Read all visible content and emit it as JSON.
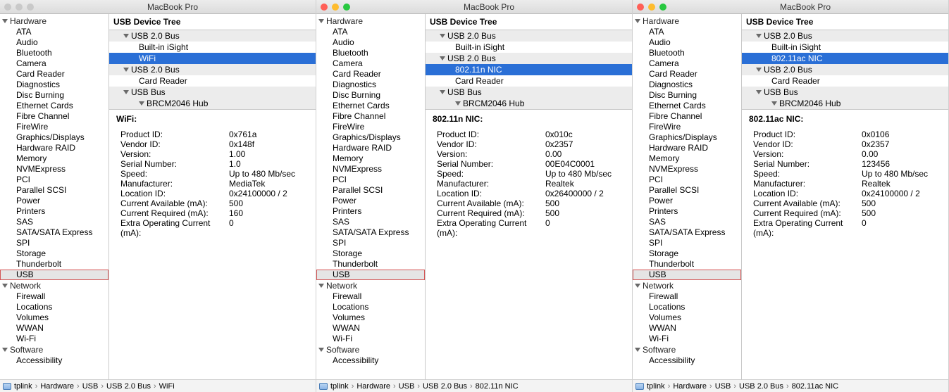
{
  "windows": [
    {
      "title": "MacBook Pro",
      "traffic_colored": false,
      "sidebar": {
        "groups": [
          {
            "label": "Hardware",
            "items": [
              "ATA",
              "Audio",
              "Bluetooth",
              "Camera",
              "Card Reader",
              "Diagnostics",
              "Disc Burning",
              "Ethernet Cards",
              "Fibre Channel",
              "FireWire",
              "Graphics/Displays",
              "Hardware RAID",
              "Memory",
              "NVMExpress",
              "PCI",
              "Parallel SCSI",
              "Power",
              "Printers",
              "SAS",
              "SATA/SATA Express",
              "SPI",
              "Storage",
              "Thunderbolt",
              "USB"
            ],
            "selected": "USB",
            "boxed": "USB"
          },
          {
            "label": "Network",
            "items": [
              "Firewall",
              "Locations",
              "Volumes",
              "WWAN",
              "Wi-Fi"
            ]
          },
          {
            "label": "Software",
            "items": [
              "Accessibility"
            ]
          }
        ]
      },
      "tree": {
        "header": "USB Device Tree",
        "rows": [
          {
            "type": "bus",
            "label": "USB 2.0 Bus"
          },
          {
            "type": "dev",
            "label": "Built-in iSight"
          },
          {
            "type": "dev",
            "label": "WiFi",
            "selected": true
          },
          {
            "type": "bus",
            "label": "USB 2.0 Bus"
          },
          {
            "type": "dev",
            "label": "Card Reader"
          },
          {
            "type": "bus",
            "label": "USB Bus"
          },
          {
            "type": "bus",
            "label": "BRCM2046 Hub",
            "indent": 1
          }
        ]
      },
      "detail": {
        "heading": "WiFi:",
        "rows": [
          {
            "k": "Product ID:",
            "v": "0x761a"
          },
          {
            "k": "Vendor ID:",
            "v": "0x148f"
          },
          {
            "k": "Version:",
            "v": "1.00"
          },
          {
            "k": "Serial Number:",
            "v": "1.0"
          },
          {
            "k": "Speed:",
            "v": "Up to 480 Mb/sec"
          },
          {
            "k": "Manufacturer:",
            "v": "MediaTek"
          },
          {
            "k": "Location ID:",
            "v": "0x24100000 / 2"
          },
          {
            "k": "Current Available (mA):",
            "v": "500"
          },
          {
            "k": "Current Required (mA):",
            "v": "160"
          },
          {
            "k": "Extra Operating Current (mA):",
            "v": "0"
          }
        ]
      },
      "breadcrumb": [
        "tplink",
        "Hardware",
        "USB",
        "USB 2.0 Bus",
        "WiFi"
      ]
    },
    {
      "title": "MacBook Pro",
      "traffic_colored": true,
      "sidebar": {
        "groups": [
          {
            "label": "Hardware",
            "items": [
              "ATA",
              "Audio",
              "Bluetooth",
              "Camera",
              "Card Reader",
              "Diagnostics",
              "Disc Burning",
              "Ethernet Cards",
              "Fibre Channel",
              "FireWire",
              "Graphics/Displays",
              "Hardware RAID",
              "Memory",
              "NVMExpress",
              "PCI",
              "Parallel SCSI",
              "Power",
              "Printers",
              "SAS",
              "SATA/SATA Express",
              "SPI",
              "Storage",
              "Thunderbolt",
              "USB"
            ],
            "selected": "USB",
            "boxed": "USB"
          },
          {
            "label": "Network",
            "items": [
              "Firewall",
              "Locations",
              "Volumes",
              "WWAN",
              "Wi-Fi"
            ]
          },
          {
            "label": "Software",
            "items": [
              "Accessibility"
            ]
          }
        ]
      },
      "tree": {
        "header": "USB Device Tree",
        "rows": [
          {
            "type": "bus",
            "label": "USB 2.0 Bus"
          },
          {
            "type": "dev",
            "label": "Built-in iSight"
          },
          {
            "type": "bus",
            "label": "USB 2.0 Bus"
          },
          {
            "type": "dev",
            "label": "802.11n NIC",
            "selected": true
          },
          {
            "type": "dev",
            "label": "Card Reader"
          },
          {
            "type": "bus",
            "label": "USB Bus"
          },
          {
            "type": "bus",
            "label": "BRCM2046 Hub",
            "indent": 1
          }
        ]
      },
      "detail": {
        "heading": "802.11n NIC:",
        "rows": [
          {
            "k": "Product ID:",
            "v": "0x010c"
          },
          {
            "k": "Vendor ID:",
            "v": "0x2357"
          },
          {
            "k": "Version:",
            "v": "0.00"
          },
          {
            "k": "Serial Number:",
            "v": "00E04C0001"
          },
          {
            "k": "Speed:",
            "v": "Up to 480 Mb/sec"
          },
          {
            "k": "Manufacturer:",
            "v": "Realtek"
          },
          {
            "k": "Location ID:",
            "v": "0x26400000 / 2"
          },
          {
            "k": "Current Available (mA):",
            "v": "500"
          },
          {
            "k": "Current Required (mA):",
            "v": "500"
          },
          {
            "k": "Extra Operating Current (mA):",
            "v": "0"
          }
        ]
      },
      "breadcrumb": [
        "tplink",
        "Hardware",
        "USB",
        "USB 2.0 Bus",
        "802.11n NIC"
      ]
    },
    {
      "title": "MacBook Pro",
      "traffic_colored": true,
      "sidebar": {
        "groups": [
          {
            "label": "Hardware",
            "items": [
              "ATA",
              "Audio",
              "Bluetooth",
              "Camera",
              "Card Reader",
              "Diagnostics",
              "Disc Burning",
              "Ethernet Cards",
              "Fibre Channel",
              "FireWire",
              "Graphics/Displays",
              "Hardware RAID",
              "Memory",
              "NVMExpress",
              "PCI",
              "Parallel SCSI",
              "Power",
              "Printers",
              "SAS",
              "SATA/SATA Express",
              "SPI",
              "Storage",
              "Thunderbolt",
              "USB"
            ],
            "selected": "USB",
            "boxed": "USB"
          },
          {
            "label": "Network",
            "items": [
              "Firewall",
              "Locations",
              "Volumes",
              "WWAN",
              "Wi-Fi"
            ]
          },
          {
            "label": "Software",
            "items": [
              "Accessibility"
            ]
          }
        ]
      },
      "tree": {
        "header": "USB Device Tree",
        "rows": [
          {
            "type": "bus",
            "label": "USB 2.0 Bus"
          },
          {
            "type": "dev",
            "label": "Built-in iSight"
          },
          {
            "type": "dev",
            "label": "802.11ac NIC",
            "selected": true
          },
          {
            "type": "bus",
            "label": "USB 2.0 Bus"
          },
          {
            "type": "dev",
            "label": "Card Reader"
          },
          {
            "type": "bus",
            "label": "USB Bus"
          },
          {
            "type": "bus",
            "label": "BRCM2046 Hub",
            "indent": 1
          }
        ]
      },
      "detail": {
        "heading": "802.11ac NIC:",
        "rows": [
          {
            "k": "Product ID:",
            "v": "0x0106"
          },
          {
            "k": "Vendor ID:",
            "v": "0x2357"
          },
          {
            "k": "Version:",
            "v": "0.00"
          },
          {
            "k": "Serial Number:",
            "v": "123456"
          },
          {
            "k": "Speed:",
            "v": "Up to 480 Mb/sec"
          },
          {
            "k": "Manufacturer:",
            "v": "Realtek"
          },
          {
            "k": "Location ID:",
            "v": "0x24100000 / 2"
          },
          {
            "k": "Current Available (mA):",
            "v": "500"
          },
          {
            "k": "Current Required (mA):",
            "v": "500"
          },
          {
            "k": "Extra Operating Current (mA):",
            "v": "0"
          }
        ]
      },
      "breadcrumb": [
        "tplink",
        "Hardware",
        "USB",
        "USB 2.0 Bus",
        "802.11ac NIC"
      ]
    }
  ]
}
